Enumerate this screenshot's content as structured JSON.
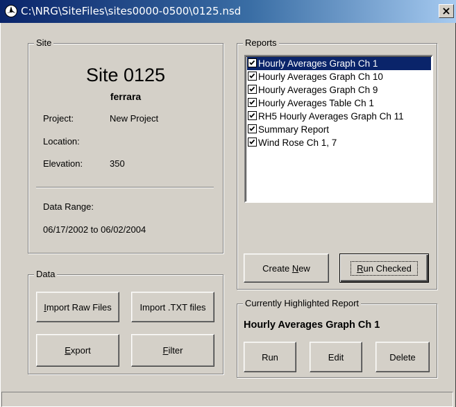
{
  "window": {
    "title": "C:\\NRG\\SiteFiles\\sites0000-0500\\0125.nsd",
    "close_glyph": "×"
  },
  "site": {
    "group_label": "Site",
    "site_title": "Site 0125",
    "site_name": "ferrara",
    "project_label": "Project:",
    "project_value": "New Project",
    "location_label": "Location:",
    "location_value": "",
    "elevation_label": "Elevation:",
    "elevation_value": "350",
    "data_range_label": "Data Range:",
    "data_range_value": "06/17/2002 to 06/02/2004"
  },
  "data_group": {
    "group_label": "Data",
    "import_raw_prefix": "",
    "import_raw_mnemonic": "I",
    "import_raw_rest": "mport Raw Files",
    "import_txt_label": "Import .TXT files",
    "export_mnemonic": "E",
    "export_rest": "xport",
    "filter_mnemonic": "F",
    "filter_rest": "ilter"
  },
  "reports": {
    "group_label": "Reports",
    "items": [
      {
        "label": "Hourly Averages Graph Ch 1",
        "checked": true,
        "selected": true
      },
      {
        "label": "Hourly Averages Graph Ch 10",
        "checked": true,
        "selected": false
      },
      {
        "label": "Hourly Averages Graph Ch 9",
        "checked": true,
        "selected": false
      },
      {
        "label": "Hourly Averages Table Ch 1",
        "checked": true,
        "selected": false
      },
      {
        "label": "RH5 Hourly Averages Graph Ch 11",
        "checked": true,
        "selected": false
      },
      {
        "label": "Summary Report",
        "checked": true,
        "selected": false
      },
      {
        "label": "Wind Rose Ch 1, 7",
        "checked": true,
        "selected": false
      }
    ],
    "create_new_prefix": "Create ",
    "create_new_mnemonic": "N",
    "create_new_rest": "ew",
    "run_checked_mnemonic": "R",
    "run_checked_rest": "un Checked"
  },
  "highlighted": {
    "group_label": "Currently Highlighted Report",
    "report_name": "Hourly Averages Graph Ch 1",
    "run_label": "Run",
    "edit_label": "Edit",
    "delete_label": "Delete"
  },
  "colors": {
    "selection": "#0a246a",
    "face": "#d4d0c8"
  }
}
